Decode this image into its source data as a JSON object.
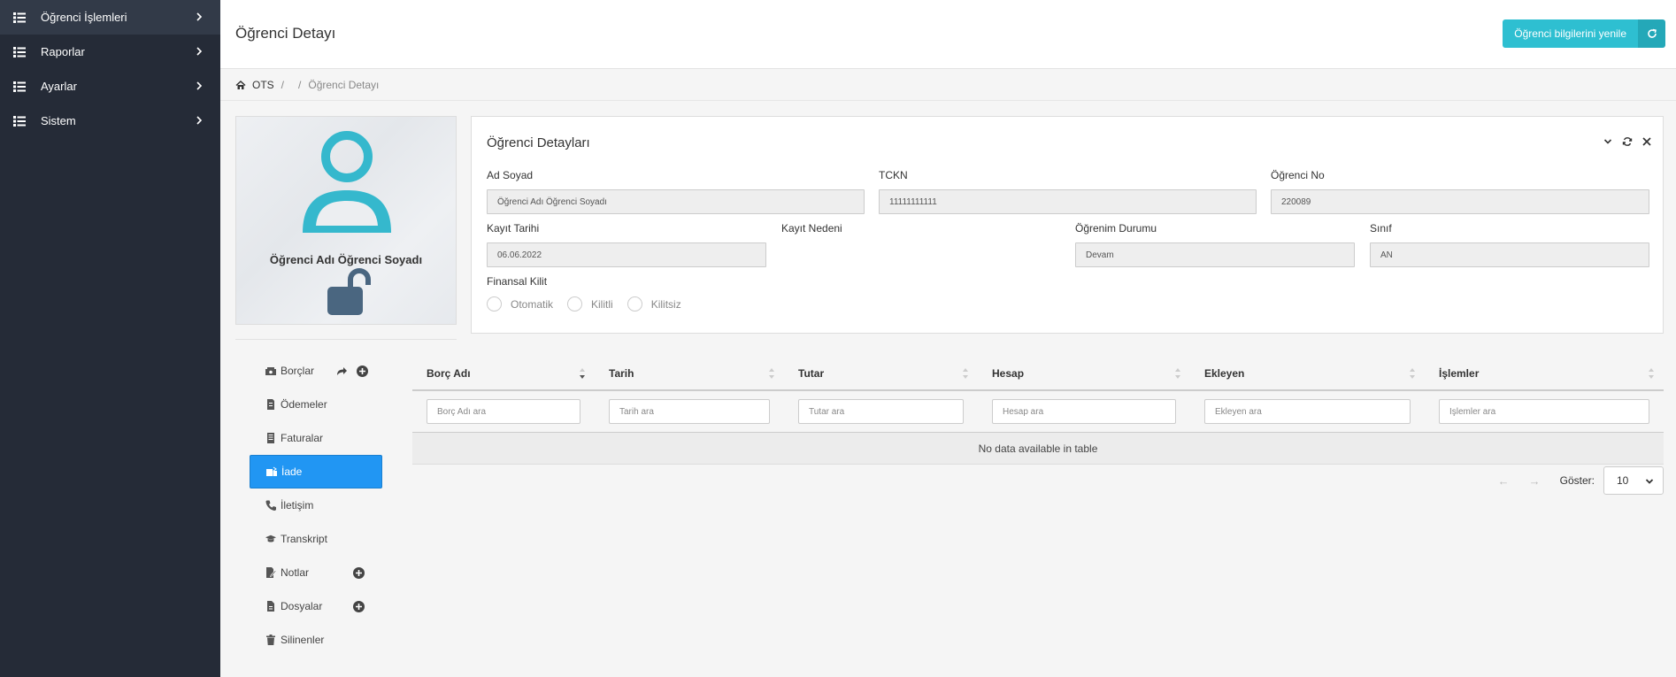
{
  "sidebar": {
    "items": [
      {
        "label": "Öğrenci İşlemleri",
        "active": true
      },
      {
        "label": "Raporlar"
      },
      {
        "label": "Ayarlar"
      },
      {
        "label": "Sistem"
      }
    ]
  },
  "header": {
    "title": "Öğrenci Detayı",
    "refresh_label": "Öğrenci bilgilerini yenile"
  },
  "breadcrumb": {
    "root": "OTS",
    "sep1": "/",
    "sep2": "/",
    "current": "Öğrenci Detayı"
  },
  "profile": {
    "name": "Öğrenci Adı Öğrenci Soyadı"
  },
  "details": {
    "title": "Öğrenci Detayları",
    "ad_soyad_label": "Ad Soyad",
    "ad_soyad_value": "Öğrenci Adı Öğrenci Soyadı",
    "tckn_label": "TCKN",
    "tckn_value": "11111111111",
    "ogrenci_no_label": "Öğrenci No",
    "ogrenci_no_value": "220089",
    "kayit_tarihi_label": "Kayıt Tarihi",
    "kayit_tarihi_value": "06.06.2022",
    "kayit_nedeni_label": "Kayıt Nedeni",
    "ogrenim_durumu_label": "Öğrenim Durumu",
    "ogrenim_durumu_value": "Devam",
    "sinif_label": "Sınıf",
    "sinif_value": "AN",
    "finansal_kilit_label": "Finansal Kilit",
    "radio_options": [
      "Otomatik",
      "Kilitli",
      "Kilitsiz"
    ]
  },
  "leftnav": {
    "items": [
      {
        "label": "Borçlar",
        "icon": "money-icon"
      },
      {
        "label": "Ödemeler",
        "icon": "receipt-icon"
      },
      {
        "label": "Faturalar",
        "icon": "invoice-icon"
      },
      {
        "label": "İade",
        "icon": "refund-icon",
        "active": true
      },
      {
        "label": "İletişim",
        "icon": "phone-icon"
      },
      {
        "label": "Transkript",
        "icon": "graduation-cap-icon"
      },
      {
        "label": "Notlar",
        "icon": "note-icon"
      },
      {
        "label": "Dosyalar",
        "icon": "file-icon"
      },
      {
        "label": "Silinenler",
        "icon": "trash-icon"
      }
    ]
  },
  "table": {
    "columns": [
      "Borç Adı",
      "Tarih",
      "Tutar",
      "Hesap",
      "Ekleyen",
      "İşlemler"
    ],
    "filters": [
      "Borç Adı ara",
      "Tarih ara",
      "Tutar ara",
      "Hesap ara",
      "Ekleyen ara",
      "İşlemler ara"
    ],
    "empty_message": "No data available in table",
    "prev": "←",
    "next": "→",
    "show_label": "Göster:",
    "page_size": "10"
  },
  "colors": {
    "sidebar_bg": "#252b37",
    "accent": "#2ebfd1",
    "active_nav": "#2196f3"
  }
}
